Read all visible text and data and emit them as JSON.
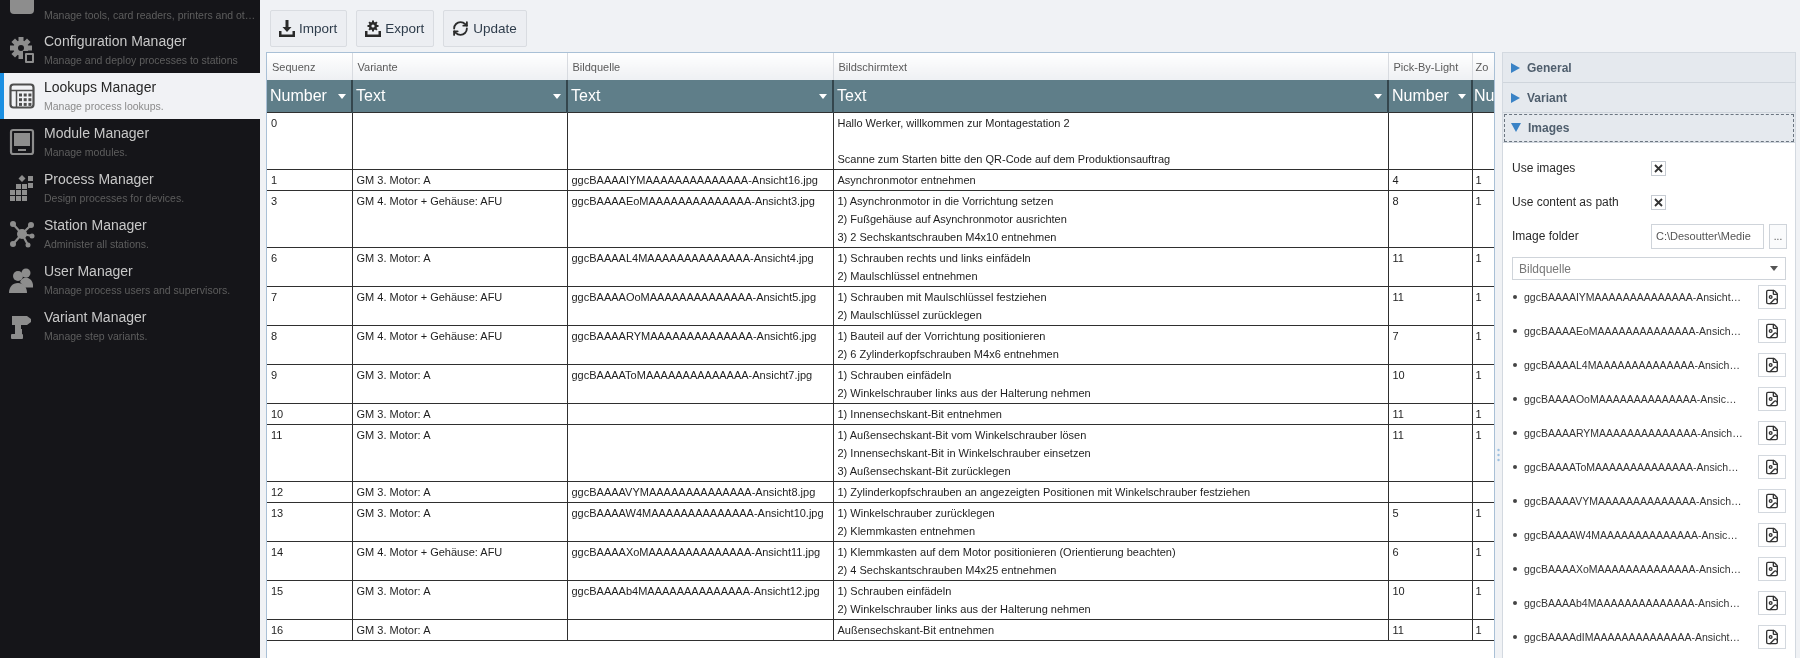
{
  "sidebar": {
    "items": [
      {
        "kind": "assets",
        "description": "Manage tools, card readers, printers and ot…",
        "selected": false
      },
      {
        "kind": "configuration",
        "title": "Configuration Manager",
        "description": "Manage and deploy processes to stations",
        "selected": false
      },
      {
        "kind": "lookups",
        "title": "Lookups Manager",
        "description": "Manage process lookups.",
        "selected": true
      },
      {
        "kind": "modules",
        "title": "Module Manager",
        "description": "Manage modules.",
        "selected": false
      },
      {
        "kind": "processes",
        "title": "Process Manager",
        "description": "Design processes for devices.",
        "selected": false
      },
      {
        "kind": "stations",
        "title": "Station Manager",
        "description": "Administer all stations.",
        "selected": false
      },
      {
        "kind": "users",
        "title": "User Manager",
        "description": "Manage process users and supervisors.",
        "selected": false
      },
      {
        "kind": "variants",
        "title": "Variant Manager",
        "description": "Manage step variants.",
        "selected": false
      }
    ]
  },
  "toolbar": {
    "buttons": [
      {
        "kind": "import",
        "label": "Import"
      },
      {
        "kind": "export",
        "label": "Export"
      },
      {
        "kind": "update",
        "label": "Update"
      }
    ]
  },
  "table": {
    "columns": [
      {
        "name": "Sequenz",
        "type": "Number"
      },
      {
        "name": "Variante",
        "type": "Text"
      },
      {
        "name": "Bildquelle",
        "type": "Text"
      },
      {
        "name": "Bildschirmtext",
        "type": "Text"
      },
      {
        "name": "Pick-By-Light",
        "type": "Number"
      },
      {
        "name": "Zo",
        "type": "Nu"
      }
    ],
    "rows": [
      {
        "sequenz": "0",
        "bildschirmtext": "Hallo Werker, willkommen zur Montagestation 2\n\nScanne zum Starten bitte den QR-Code auf dem Produktionsauftrag"
      },
      {
        "sequenz": "1",
        "variante": "GM 3. Motor: A",
        "bildquelle": "ggcBAAAAIYMAAAAAAAAAAAAAA-Ansicht16.jpg",
        "bildschirmtext": "Asynchronmotor entnehmen",
        "pick_by_light": "4",
        "column_6": "1"
      },
      {
        "sequenz": "3",
        "variante": "GM 4. Motor + Gehäuse: AFU",
        "bildquelle": "ggcBAAAAEoMAAAAAAAAAAAAAA-Ansicht3.jpg",
        "bildschirmtext": "1) Asynchronmotor in die Vorrichtung setzen\n2) Fußgehäuse auf Asynchronmotor ausrichten\n3) 2 Sechskantschrauben M4x10 entnehmen",
        "pick_by_light": "8",
        "column_6": "1"
      },
      {
        "sequenz": "6",
        "variante": "GM 3. Motor: A",
        "bildquelle": "ggcBAAAAL4MAAAAAAAAAAAAAA-Ansicht4.jpg",
        "bildschirmtext": "1) Schrauben rechts und links einfädeln\n2) Maulschlüssel entnehmen",
        "pick_by_light": "11",
        "column_6": "1"
      },
      {
        "sequenz": "7",
        "variante": "GM 4. Motor + Gehäuse: AFU",
        "bildquelle": "ggcBAAAAOoMAAAAAAAAAAAAAA-Ansicht5.jpg",
        "bildschirmtext": "1) Schrauben mit Maulschlüssel festziehen\n2) Maulschlüssel zurücklegen",
        "pick_by_light": "11",
        "column_6": "1"
      },
      {
        "sequenz": "8",
        "variante": "GM 4. Motor + Gehäuse: AFU",
        "bildquelle": "ggcBAAAARYMAAAAAAAAAAAAAA-Ansicht6.jpg",
        "bildschirmtext": "1) Bauteil auf der Vorrichtung positionieren\n2) 6 Zylinderkopfschrauben M4x6 entnehmen",
        "pick_by_light": "7",
        "column_6": "1"
      },
      {
        "sequenz": "9",
        "variante": "GM 3. Motor: A",
        "bildquelle": "ggcBAAAAToMAAAAAAAAAAAAAA-Ansicht7.jpg",
        "bildschirmtext": "1) Schrauben einfädeln\n2) Winkelschrauber links aus der Halterung nehmen",
        "pick_by_light": "10",
        "column_6": "1"
      },
      {
        "sequenz": "10",
        "variante": "GM 3. Motor: A",
        "bildschirmtext": "1) Innensechskant-Bit entnehmen",
        "pick_by_light": "11",
        "column_6": "1"
      },
      {
        "sequenz": "11",
        "variante": "GM 3. Motor: A",
        "bildschirmtext": "1) Außensechskant-Bit vom Winkelschrauber lösen\n2) Innensechskant-Bit in Winkelschrauber einsetzen\n3) Außensechskant-Bit zurücklegen",
        "pick_by_light": "11",
        "column_6": "1"
      },
      {
        "sequenz": "12",
        "variante": "GM 3. Motor: A",
        "bildquelle": "ggcBAAAAVYMAAAAAAAAAAAAAA-Ansicht8.jpg",
        "bildschirmtext": "1) Zylinderkopfschrauben an angezeigten Positionen mit Winkelschrauber festziehen"
      },
      {
        "sequenz": "13",
        "variante": "GM 3. Motor: A",
        "bildquelle": "ggcBAAAAW4MAAAAAAAAAAAAAA-Ansicht10.jpg",
        "bildschirmtext": "1) Winkelschrauber zurücklegen\n2) Klemmkasten entnehmen",
        "pick_by_light": "5",
        "column_6": "1"
      },
      {
        "sequenz": "14",
        "variante": "GM 4. Motor + Gehäuse: AFU",
        "bildquelle": "ggcBAAAAXoMAAAAAAAAAAAAAA-Ansicht11.jpg",
        "bildschirmtext": "1) Klemmkasten auf dem Motor positionieren (Orientierung beachten)\n2) 4 Sechskantschrauben M4x25 entnehmen",
        "pick_by_light": "6",
        "column_6": "1"
      },
      {
        "sequenz": "15",
        "variante": "GM 3. Motor: A",
        "bildquelle": "ggcBAAAAb4MAAAAAAAAAAAAAA-Ansicht12.jpg",
        "bildschirmtext": "1) Schrauben einfädeln\n2) Winkelschrauber links aus der Halterung nehmen",
        "pick_by_light": "10",
        "column_6": "1"
      },
      {
        "sequenz": "16",
        "variante": "GM 3. Motor: A",
        "bildschirmtext": "Außensechskant-Bit entnehmen",
        "pick_by_light": "11",
        "column_6": "1"
      }
    ]
  },
  "details_panel": {
    "sections": [
      {
        "title": "General",
        "expanded": false,
        "focused": false
      },
      {
        "title": "Variant",
        "expanded": false,
        "focused": false
      },
      {
        "title": "Images",
        "expanded": true,
        "focused": true,
        "checkboxes": [
          {
            "label": "Use images",
            "checked": true
          },
          {
            "label": "Use content as path",
            "checked": true
          }
        ],
        "image_folder": {
          "label": "Image folder",
          "value": "C:\\Desoutter\\Medie",
          "browse_label": "..."
        },
        "source_select": {
          "value": "Bildquelle"
        },
        "files": [
          "ggcBAAAAIYMAAAAAAAAAAAAAA-Ansicht…",
          "ggcBAAAAEoMAAAAAAAAAAAAAA-Ansich…",
          "ggcBAAAAL4MAAAAAAAAAAAAAA-Ansich…",
          "ggcBAAAAOoMAAAAAAAAAAAAAA-Ansic…",
          "ggcBAAAARYMAAAAAAAAAAAAAA-Ansich…",
          "ggcBAAAAToMAAAAAAAAAAAAAA-Ansich…",
          "ggcBAAAAVYMAAAAAAAAAAAAAA-Ansich…",
          "ggcBAAAAW4MAAAAAAAAAAAAAA-Ansic…",
          "ggcBAAAAXoMAAAAAAAAAAAAAA-Ansich…",
          "ggcBAAAAb4MAAAAAAAAAAAAAA-Ansich…",
          "ggcBAAAAdIMAAAAAAAAAAAAAA-Ansicht…"
        ]
      }
    ]
  }
}
